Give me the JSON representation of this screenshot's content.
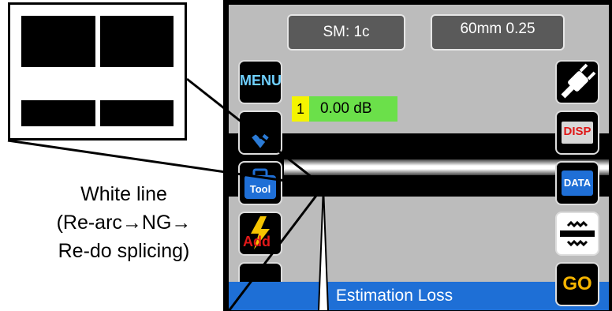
{
  "header": {
    "fiber_mode": "SM: 1c",
    "cleave_setting": "60mm 0.25"
  },
  "left_buttons": {
    "menu": "MENU",
    "tool": "Tool",
    "add": "Add"
  },
  "right_buttons": {
    "disp": "DISP",
    "data": "DATA",
    "go": "GO"
  },
  "loss": {
    "index": "1",
    "value": "0.00 dB"
  },
  "status": {
    "text": "Estimation Loss"
  },
  "callout": {
    "caption_line1": "White line",
    "caption_line2": "(Re-arc→NG→",
    "caption_line3": "Re-do splicing)"
  },
  "colors": {
    "status_bar": "#1e6fd6",
    "loss_index_bg": "#f4f400",
    "loss_value_bg": "#6be04a",
    "menu_text": "#6fd0ff",
    "go_text": "#f5b400"
  }
}
